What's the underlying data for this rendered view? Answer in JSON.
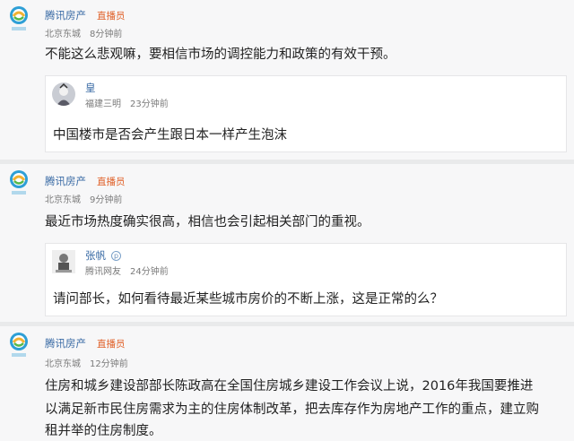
{
  "comments": [
    {
      "author": "腾讯房产",
      "badge": "直播员",
      "location": "北京东城",
      "time": "8分钟前",
      "text": "不能这么悲观嘛，要相信市场的调控能力和政策的有效干预。",
      "quoted": {
        "author": "皇",
        "location": "福建三明",
        "time": "23分钟前",
        "text": "中国楼市是否会产生跟日本一样产生泡沫"
      }
    },
    {
      "author": "腾讯房产",
      "badge": "直播员",
      "location": "北京东城",
      "time": "9分钟前",
      "text": "最近市场热度确实很高，相信也会引起相关部门的重视。",
      "quoted": {
        "author": "张帆",
        "location": "腾讯网友",
        "time": "24分钟前",
        "text": "请问部长，如何看待最近某些城市房价的不断上涨，这是正常的么？"
      }
    },
    {
      "author": "腾讯房产",
      "badge": "直播员",
      "location": "北京东城",
      "time": "12分钟前",
      "text_lines": [
        "住房和城乡建设部部长陈政高在全国住房城乡建设工作会议上说，2016年我国要推进",
        "以满足新市民住房需求为主的住房体制改革，把去库存作为房地产工作的重点，建立购",
        "租并举的住房制度。"
      ]
    }
  ],
  "colors": {
    "author": "#3a6ba5",
    "badge": "#e0622a",
    "panel": "#f7f7f8",
    "separator": "#e9eaeb"
  },
  "icons": {
    "logo": "tencent-house-logo-icon",
    "verified": "verified-icon"
  }
}
